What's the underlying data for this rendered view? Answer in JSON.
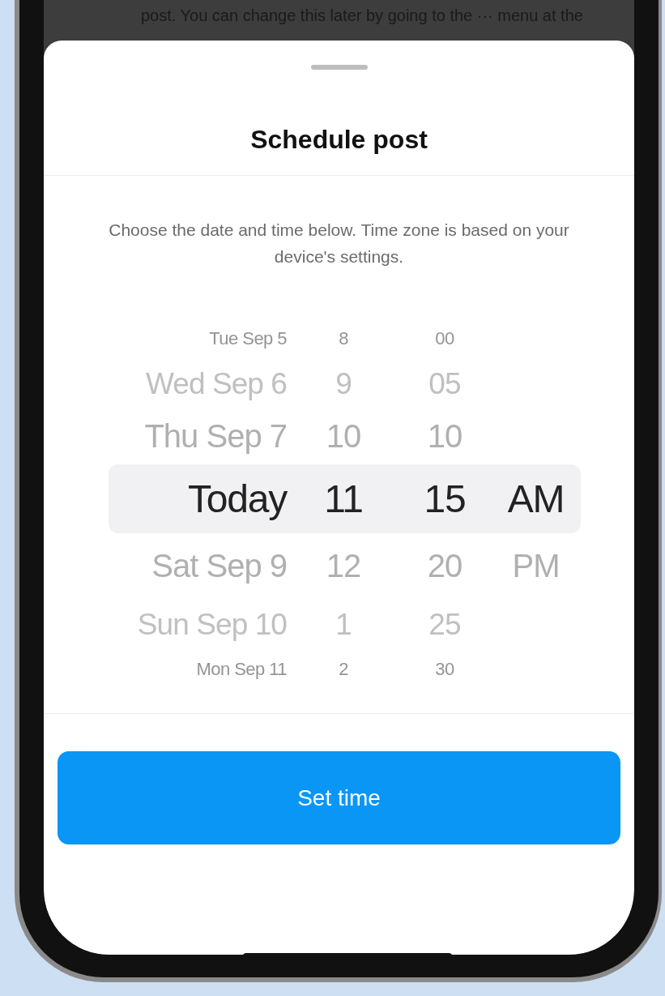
{
  "background_text": "post. You can change this later by going to the ··· menu at the",
  "sheet": {
    "title": "Schedule post",
    "description": "Choose the date and time below. Time zone is based on your device's settings."
  },
  "picker": {
    "columns": [
      {
        "kind": "date",
        "items": [
          {
            "text": "Tue Sep 5",
            "selected": false
          },
          {
            "text": "Wed Sep 6",
            "selected": false
          },
          {
            "text": "Thu Sep 7",
            "selected": false
          },
          {
            "text": "Today",
            "selected": true
          },
          {
            "text": "Sat Sep 9",
            "selected": false
          },
          {
            "text": "Sun Sep 10",
            "selected": false
          },
          {
            "text": "Mon Sep 11",
            "selected": false
          }
        ]
      },
      {
        "kind": "hour",
        "items": [
          {
            "text": "8",
            "selected": false
          },
          {
            "text": "9",
            "selected": false
          },
          {
            "text": "10",
            "selected": false
          },
          {
            "text": "11",
            "selected": true
          },
          {
            "text": "12",
            "selected": false
          },
          {
            "text": "1",
            "selected": false
          },
          {
            "text": "2",
            "selected": false
          }
        ]
      },
      {
        "kind": "minute",
        "items": [
          {
            "text": "00",
            "selected": false
          },
          {
            "text": "05",
            "selected": false
          },
          {
            "text": "10",
            "selected": false
          },
          {
            "text": "15",
            "selected": true
          },
          {
            "text": "20",
            "selected": false
          },
          {
            "text": "25",
            "selected": false
          },
          {
            "text": "30",
            "selected": false
          }
        ]
      },
      {
        "kind": "period",
        "items": [
          {
            "text": "AM",
            "selected": true
          },
          {
            "text": "PM",
            "selected": false
          }
        ]
      }
    ]
  },
  "button": {
    "label": "Set time"
  }
}
